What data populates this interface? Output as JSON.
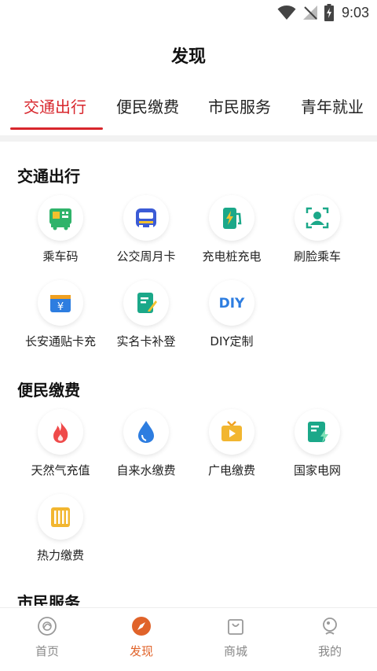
{
  "status_bar": {
    "time": "9:03"
  },
  "page_title": "发现",
  "tabs": [
    {
      "label": "交通出行",
      "active": true
    },
    {
      "label": "便民缴费",
      "active": false
    },
    {
      "label": "市民服务",
      "active": false
    },
    {
      "label": "青年就业",
      "active": false
    }
  ],
  "sections": [
    {
      "title": "交通出行",
      "items": [
        {
          "label": "乘车码",
          "icon": "bus-code-icon"
        },
        {
          "label": "公交周月卡",
          "icon": "bus-card-icon"
        },
        {
          "label": "充电桩充电",
          "icon": "charging-pile-icon"
        },
        {
          "label": "刷脸乘车",
          "icon": "face-scan-icon"
        },
        {
          "label": "长安通贴卡充",
          "icon": "wallet-yuan-icon"
        },
        {
          "label": "实名卡补登",
          "icon": "edit-card-icon"
        },
        {
          "label": "DIY定制",
          "icon": "diy-icon"
        }
      ]
    },
    {
      "title": "便民缴费",
      "items": [
        {
          "label": "天然气充值",
          "icon": "flame-icon"
        },
        {
          "label": "自来水缴费",
          "icon": "water-drop-icon"
        },
        {
          "label": "广电缴费",
          "icon": "tv-icon"
        },
        {
          "label": "国家电网",
          "icon": "power-grid-icon"
        },
        {
          "label": "热力缴费",
          "icon": "radiator-icon"
        }
      ]
    },
    {
      "title": "市民服务",
      "items": []
    }
  ],
  "bottom_nav": [
    {
      "label": "首页",
      "icon": "home-icon",
      "active": false
    },
    {
      "label": "发现",
      "icon": "compass-icon",
      "active": true
    },
    {
      "label": "商城",
      "icon": "shopping-bag-icon",
      "active": false
    },
    {
      "label": "我的",
      "icon": "profile-icon",
      "active": false
    }
  ],
  "colors": {
    "accent_red": "#d8262c",
    "nav_active": "#e0632a",
    "green": "#2fb36a",
    "blue": "#3b5bd6",
    "teal": "#1ba889",
    "yellow": "#f2c12e",
    "orange": "#f0a020"
  }
}
